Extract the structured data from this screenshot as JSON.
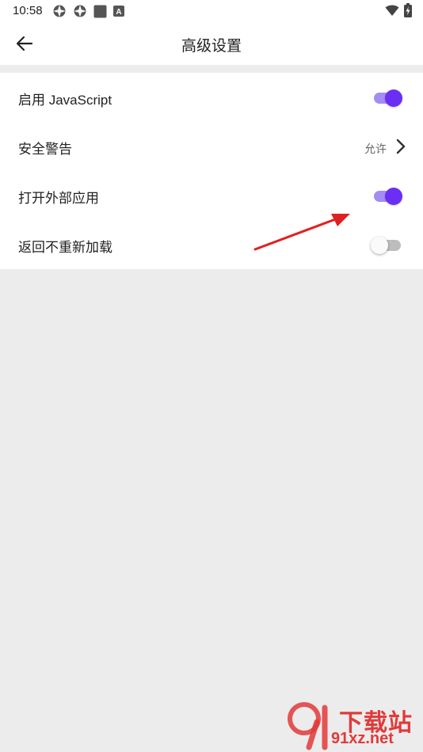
{
  "status_bar": {
    "time": "10:58",
    "left_icons": [
      "settings-gear-icon",
      "settings-gear-icon",
      "square-notification-icon",
      "a-notification-icon"
    ],
    "right_icons": [
      "wifi-icon",
      "battery-charging-icon"
    ],
    "a_icon_letter": "A"
  },
  "app_bar": {
    "title": "高级设置",
    "back_icon": "arrow-left-icon"
  },
  "settings": [
    {
      "label": "启用 JavaScript",
      "type": "toggle",
      "enabled": true
    },
    {
      "label": "安全警告",
      "type": "link",
      "value": "允许"
    },
    {
      "label": "打开外部应用",
      "type": "toggle",
      "enabled": true
    },
    {
      "label": "返回不重新加载",
      "type": "toggle",
      "enabled": false
    }
  ],
  "colors": {
    "accent": "#6a2ef5",
    "accent_track": "#a48cf5",
    "annotation": "#e02020",
    "background": "#ececec"
  },
  "watermark": {
    "top_text": "下载站",
    "bottom_text": "91xz.net"
  }
}
